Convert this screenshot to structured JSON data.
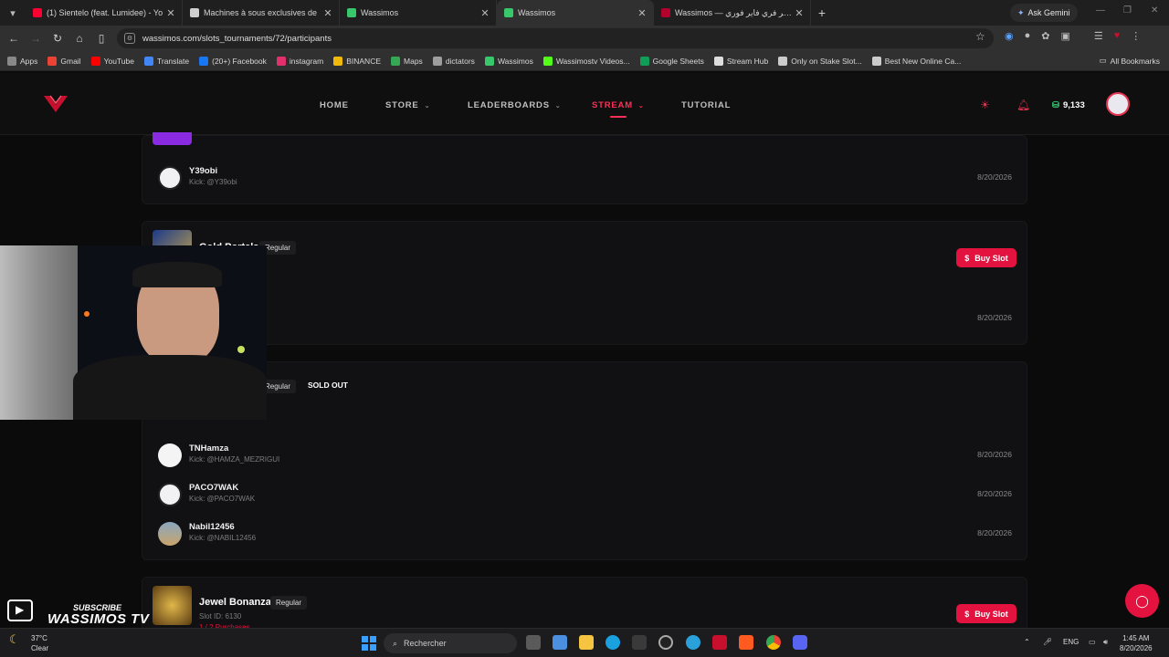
{
  "browser": {
    "tabs": [
      {
        "title": "(1) Sientelo (feat. Lumidee) - Yo",
        "color": "#ff0033"
      },
      {
        "title": "Machines à sous exclusives de ",
        "color": "#cfcfcf"
      },
      {
        "title": "Wassimos",
        "color": "#38c76b"
      },
      {
        "title": "Wassimos",
        "color": "#38c76b"
      },
      {
        "title": "Wassimos — جواهر فري فاير فوري",
        "color": "#b3002d"
      }
    ],
    "ask_gemini": "Ask Gemini",
    "url": "wassimos.com/slots_tournaments/72/participants",
    "bookmarks": [
      {
        "label": "Apps",
        "color": "#888888"
      },
      {
        "label": "Gmail",
        "color": "#ea4335"
      },
      {
        "label": "YouTube",
        "color": "#ff0000"
      },
      {
        "label": "Translate",
        "color": "#4285f4"
      },
      {
        "label": "(20+) Facebook",
        "color": "#1877f2"
      },
      {
        "label": "instagram",
        "color": "#e1306c"
      },
      {
        "label": "BINANCE",
        "color": "#f0b90b"
      },
      {
        "label": "Maps",
        "color": "#34a853"
      },
      {
        "label": "dictators",
        "color": "#9e9e9e"
      },
      {
        "label": "Wassimos",
        "color": "#38c76b"
      },
      {
        "label": "Wassimostv Videos...",
        "color": "#53fc18"
      },
      {
        "label": "Google Sheets",
        "color": "#0f9d58"
      },
      {
        "label": "Stream Hub",
        "color": "#dddddd"
      },
      {
        "label": "Only on Stake Slot...",
        "color": "#cccccc"
      },
      {
        "label": "Best New Online Ca...",
        "color": "#cccccc"
      }
    ],
    "all_bookmarks": "All Bookmarks"
  },
  "header": {
    "nav": {
      "home": "HOME",
      "store": "STORE",
      "leaderboards": "LEADERBOARDS",
      "stream": "STREAM",
      "tutorial": "TUTORIAL"
    },
    "balance": "9,133",
    "accent": "#ff2f55"
  },
  "participants_top": [
    {
      "name": "Y39obi",
      "kick": "Kick: @Y39obi",
      "date": "8/20/2026"
    }
  ],
  "game1": {
    "title": "Gold Portals",
    "type": "Regular",
    "buy_label": "Buy Slot",
    "row_date": "8/20/2026"
  },
  "game2": {
    "type": "Regular",
    "status": "SOLD OUT"
  },
  "participants_mid": [
    {
      "name": "TNHamza",
      "kick": "Kick: @HAMZA_MEZRIGUI",
      "date": "8/20/2026"
    },
    {
      "name": "PACO7WAK",
      "kick": "Kick: @PACO7WAK",
      "date": "8/20/2026"
    },
    {
      "name": "Nabil12456",
      "kick": "Kick: @NABIL12456",
      "date": "8/20/2026"
    }
  ],
  "game3": {
    "title": "Jewel Bonanza",
    "type": "Regular",
    "slot_id": "Slot ID: 6130",
    "purchases": "1 / 2 Purchases",
    "buy_label": "Buy Slot"
  },
  "overlay": {
    "subscribe": "SUBSCRIBE",
    "channel": "WASSIMOS TV"
  },
  "taskbar": {
    "temp": "37°C",
    "cond": "Clear",
    "search": "Rechercher",
    "lang": "ENG",
    "time": "1:45 AM",
    "date": "8/20/2026"
  }
}
